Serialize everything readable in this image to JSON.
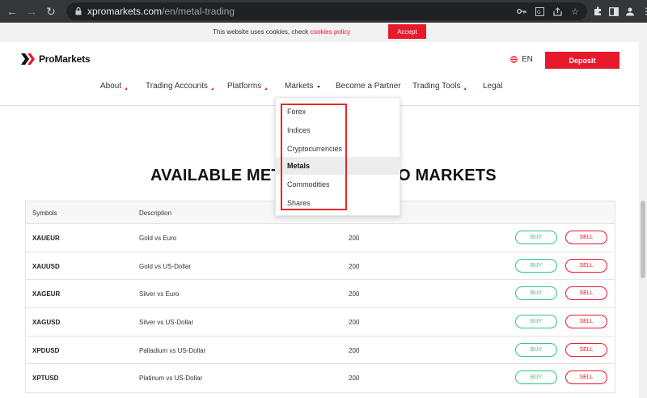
{
  "browser": {
    "url_host": "xpromarkets.com",
    "url_path": "/en/metal-trading"
  },
  "cookie_bar": {
    "text": "This website uses cookies, check ",
    "link": "cookies policy",
    "accept_label": "Accept"
  },
  "header": {
    "brand": "ProMarkets",
    "language": "EN",
    "deposit_label": "Deposit"
  },
  "nav": {
    "items": [
      {
        "label": "About",
        "marker": "triangle"
      },
      {
        "label": "Trading Accounts",
        "marker": "triangle"
      },
      {
        "label": "Platforms",
        "marker": "triangle"
      },
      {
        "label": "Markets",
        "marker": "caret"
      },
      {
        "label": "Become a Partner",
        "marker": "none"
      },
      {
        "label": "Trading Tools",
        "marker": "triangle"
      },
      {
        "label": "Legal",
        "marker": "none"
      }
    ]
  },
  "markets_dropdown": {
    "options": [
      "Forex",
      "Indices",
      "Cryptocurrencies",
      "Metals",
      "Commodities",
      "Shares"
    ],
    "selected": "Metals"
  },
  "heading": {
    "left": "AVAILABLE META",
    "right": "O MARKETS"
  },
  "table": {
    "headers": {
      "symbols": "Symbols",
      "description": "Description"
    },
    "buy_label": "BUY",
    "sell_label": "SELL",
    "rows": [
      {
        "symbol": "XAUEUR",
        "description": "Gold vs Euro",
        "leverage": "200"
      },
      {
        "symbol": "XAUUSD",
        "description": "Gold vs US-Dollar",
        "leverage": "200"
      },
      {
        "symbol": "XAGEUR",
        "description": "Silver vs Euro",
        "leverage": "200"
      },
      {
        "symbol": "XAGUSD",
        "description": "Silver vs US-Dollar",
        "leverage": "200"
      },
      {
        "symbol": "XPDUSD",
        "description": "Palladium vs US-Dollar",
        "leverage": "200"
      },
      {
        "symbol": "XPTUSD",
        "description": "Platinum vs US-Dollar",
        "leverage": "200"
      }
    ]
  },
  "colors": {
    "brand_red": "#e8192c",
    "buy_green": "#32c47a",
    "highlight_red": "#e12a2a"
  }
}
